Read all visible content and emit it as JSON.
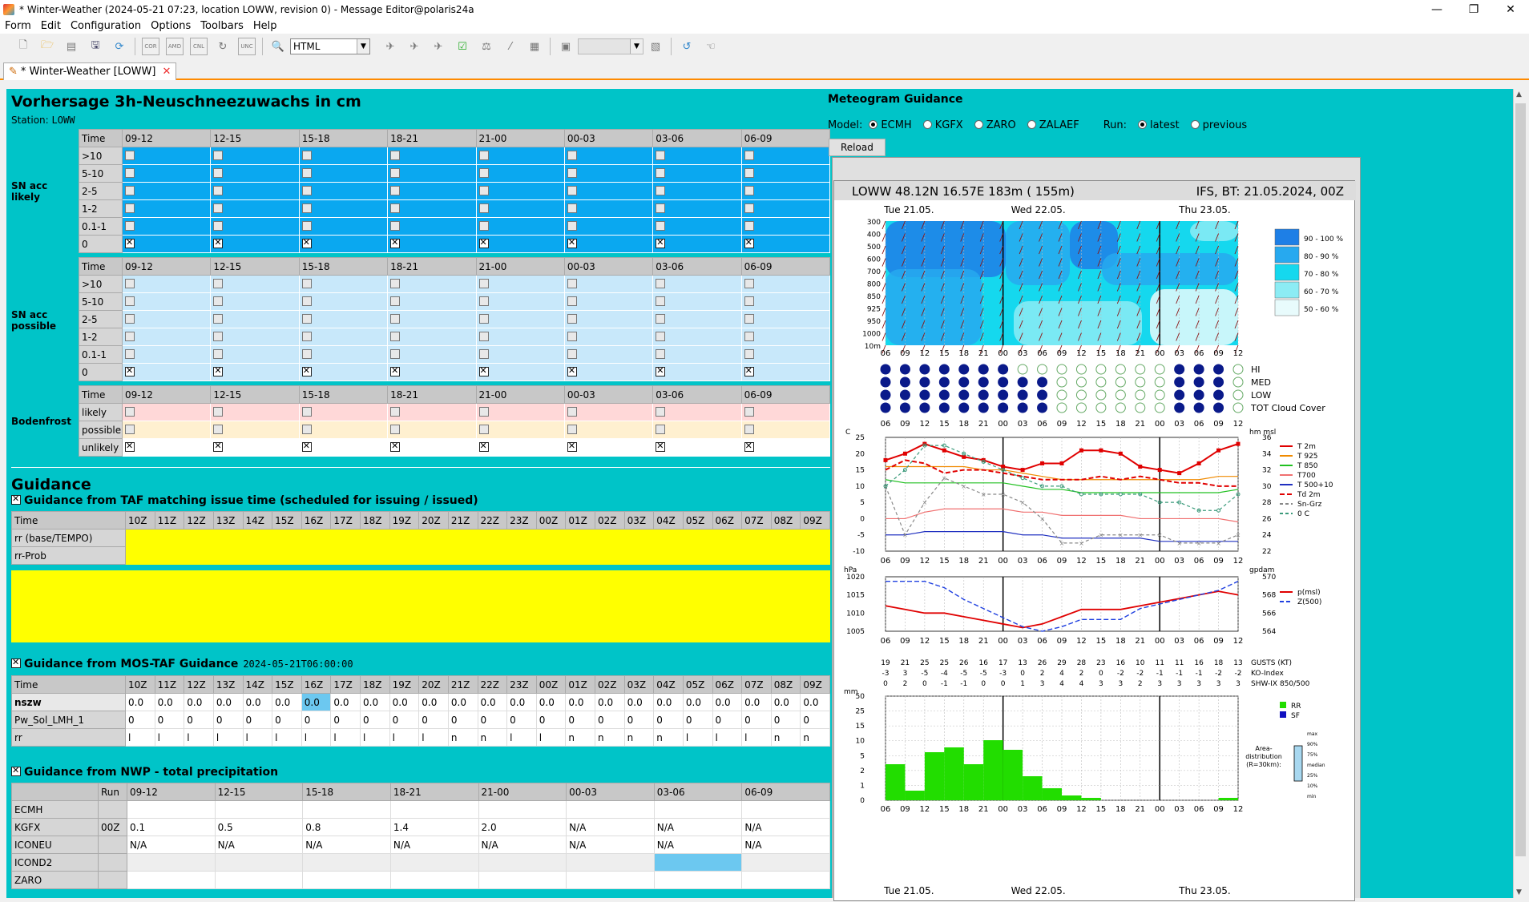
{
  "window": {
    "title": "* Winter-Weather (2024-05-21 07:23, location LOWW, revision 0) - Message Editor@polaris24a",
    "min": "—",
    "max": "❐",
    "close": "✕"
  },
  "menu": [
    "Form",
    "Edit",
    "Configuration",
    "Options",
    "Toolbars",
    "Help"
  ],
  "toolbar": {
    "format": "HTML",
    "icons": [
      "new-icon",
      "open-icon",
      "template-icon",
      "save-icon",
      "refresh-icon",
      "cor-icon",
      "amd-icon",
      "cnl-icon",
      "redo-icon",
      "unc-icon",
      "zoom-icon"
    ],
    "labels": {
      "cor": "COR",
      "amd": "AMD",
      "cnl": "CNL",
      "unc": "UNC"
    }
  },
  "tab": {
    "label": "* Winter-Weather [LOWW]",
    "close": "✕"
  },
  "left": {
    "title": "Vorhersage 3h-Neuschneezuwachs in cm",
    "station_label": "Station:",
    "station": "LOWW",
    "time_label": "Time",
    "periods": [
      "09-12",
      "12-15",
      "15-18",
      "18-21",
      "21-00",
      "00-03",
      "03-06",
      "06-09"
    ],
    "sn_likely": {
      "label_line1": "SN acc",
      "label_line2": "likely",
      "rows": [
        ">10",
        "5-10",
        "2-5",
        "1-2",
        "0.1-1",
        "0"
      ],
      "checked_row": "0"
    },
    "sn_possible": {
      "label_line1": "SN acc",
      "label_line2": "possible",
      "rows": [
        ">10",
        "5-10",
        "2-5",
        "1-2",
        "0.1-1",
        "0"
      ],
      "checked_row": "0"
    },
    "frost": {
      "label": "Bodenfrost",
      "rows": [
        "likely",
        "possible",
        "unlikely"
      ],
      "checked_row": "unlikely"
    },
    "guidance_title": "Guidance",
    "taf": {
      "title": "Guidance from TAF matching issue time (scheduled for issuing / issued)",
      "time_label": "Time",
      "hours": [
        "10Z",
        "11Z",
        "12Z",
        "13Z",
        "14Z",
        "15Z",
        "16Z",
        "17Z",
        "18Z",
        "19Z",
        "20Z",
        "21Z",
        "22Z",
        "23Z",
        "00Z",
        "01Z",
        "02Z",
        "03Z",
        "04Z",
        "05Z",
        "06Z",
        "07Z",
        "08Z",
        "09Z"
      ],
      "rows": [
        "rr (base/TEMPO)",
        "rr-Prob"
      ]
    },
    "mos": {
      "title": "Guidance from MOS-TAF Guidance",
      "timestamp": "2024-05-21T06:00:00",
      "time_label": "Time",
      "hours": [
        "10Z",
        "11Z",
        "12Z",
        "13Z",
        "14Z",
        "15Z",
        "16Z",
        "17Z",
        "18Z",
        "19Z",
        "20Z",
        "21Z",
        "22Z",
        "23Z",
        "00Z",
        "01Z",
        "02Z",
        "03Z",
        "04Z",
        "05Z",
        "06Z",
        "07Z",
        "08Z",
        "09Z"
      ],
      "rows": [
        {
          "label": "nszw",
          "values": [
            "0.0",
            "0.0",
            "0.0",
            "0.0",
            "0.0",
            "0.0",
            "0.0",
            "0.0",
            "0.0",
            "0.0",
            "0.0",
            "0.0",
            "0.0",
            "0.0",
            "0.0",
            "0.0",
            "0.0",
            "0.0",
            "0.0",
            "0.0",
            "0.0",
            "0.0",
            "0.0",
            "0.0"
          ]
        },
        {
          "label": "Pw_Sol_LMH_1",
          "values": [
            "0",
            "0",
            "0",
            "0",
            "0",
            "0",
            "0",
            "0",
            "0",
            "0",
            "0",
            "0",
            "0",
            "0",
            "0",
            "0",
            "0",
            "0",
            "0",
            "0",
            "0",
            "0",
            "0",
            "0"
          ]
        },
        {
          "label": "rr",
          "values": [
            "l",
            "l",
            "l",
            "l",
            "l",
            "l",
            "l",
            "l",
            "l",
            "l",
            "l",
            "n",
            "n",
            "l",
            "l",
            "n",
            "n",
            "n",
            "n",
            "l",
            "l",
            "l",
            "n",
            "n"
          ]
        }
      ],
      "highlight_col": 6
    },
    "nwp": {
      "title": "Guidance from NWP - total precipitation",
      "run_label": "Run",
      "periods": [
        "09-12",
        "12-15",
        "15-18",
        "18-21",
        "21-00",
        "00-03",
        "03-06",
        "06-09"
      ],
      "rows": [
        {
          "model": "ECMH",
          "run": "",
          "values": [
            "",
            "",
            "",
            "",
            "",
            "",
            "",
            ""
          ]
        },
        {
          "model": "KGFX",
          "run": "00Z",
          "values": [
            "0.1",
            "0.5",
            "0.8",
            "1.4",
            "2.0",
            "N/A",
            "N/A",
            "N/A"
          ]
        },
        {
          "model": "ICONEU",
          "run": "",
          "values": [
            "N/A",
            "N/A",
            "N/A",
            "N/A",
            "N/A",
            "N/A",
            "N/A",
            "N/A"
          ]
        },
        {
          "model": "ICOND2",
          "run": "",
          "values": [
            "",
            "",
            "",
            "",
            "",
            "",
            "",
            ""
          ]
        },
        {
          "model": "ZARO",
          "run": "",
          "values": [
            "",
            "",
            "",
            "",
            "",
            "",
            "",
            ""
          ]
        }
      ]
    }
  },
  "right": {
    "title": "Meteogram Guidance",
    "model_label": "Model:",
    "models": [
      "ECMH",
      "KGFX",
      "ZARO",
      "ZALAEF"
    ],
    "selected_model": "ECMH",
    "run_label": "Run:",
    "runs": [
      "latest",
      "previous"
    ],
    "selected_run": "latest",
    "reload": "Reload",
    "meteogram": {
      "header_left": "LOWW  48.12N  16.57E  183m  ( 155m)",
      "header_right": "IFS,   BT: 21.05.2024, 00Z",
      "days": [
        "Tue 21.05.",
        "Wed 22.05.",
        "Thu 23.05."
      ],
      "hours": [
        "06",
        "09",
        "12",
        "15",
        "18",
        "21",
        "00",
        "03",
        "06",
        "09",
        "12",
        "15",
        "18",
        "21",
        "00",
        "03",
        "06",
        "09",
        "12"
      ],
      "levels": [
        "300",
        "400",
        "500",
        "600",
        "700",
        "800",
        "850",
        "925",
        "950",
        "1000",
        "10m"
      ],
      "humidity_legend": [
        "90 - 100 %",
        "80 - 90 %",
        "70 - 80 %",
        "60 - 70 %",
        "50 - 60 %"
      ],
      "humidity_colors": [
        "#1e7fe6",
        "#27a9ef",
        "#15d8ee",
        "#8cecf4",
        "#e8fbfc"
      ],
      "cloud_labels": [
        "HI",
        "MED",
        "LOW",
        "TOT Cloud Cover"
      ],
      "temp": {
        "unit_left": "C",
        "unit_right": "hm msl",
        "y_left": [
          "25",
          "20",
          "15",
          "10",
          "5",
          "0",
          "-5",
          "-10"
        ],
        "y_right": [
          "36",
          "34",
          "32",
          "30",
          "28",
          "26",
          "24",
          "22"
        ],
        "legend": [
          "T 2m",
          "T 925",
          "T 850",
          "T700",
          "T 500+10",
          "Td 2m",
          "Sn-Grz",
          "0 C"
        ],
        "legend_colors": [
          "#e00000",
          "#f08a00",
          "#20c020",
          "#f07070",
          "#2030c0",
          "#e00000",
          "#888888",
          "#3a9a7a"
        ],
        "series": {
          "T 2m": [
            18,
            20,
            23,
            21,
            19,
            18,
            16,
            15,
            17,
            17,
            21,
            21,
            20,
            16,
            15,
            14,
            17,
            21,
            23
          ],
          "T 925": [
            16,
            16,
            16,
            16,
            16,
            15,
            15,
            14,
            13,
            12,
            12,
            12,
            12,
            12,
            12,
            12,
            12,
            13,
            13
          ],
          "T 850": [
            12,
            11,
            11,
            11,
            11,
            11,
            11,
            10,
            9,
            9,
            8,
            8,
            8,
            8,
            8,
            8,
            8,
            8,
            9
          ],
          "T700": [
            0,
            0,
            2,
            3,
            3,
            3,
            3,
            2,
            2,
            1,
            1,
            1,
            1,
            0,
            0,
            0,
            0,
            0,
            -1
          ],
          "T 500+10": [
            -5,
            -5,
            -4,
            -4,
            -4,
            -4,
            -4,
            -5,
            -5,
            -6,
            -6,
            -6,
            -6,
            -6,
            -7,
            -7,
            -7,
            -7,
            -7
          ],
          "Td 2m": [
            15,
            18,
            17,
            14,
            15,
            15,
            14,
            13,
            12,
            12,
            12,
            13,
            12,
            13,
            12,
            11,
            11,
            10,
            10
          ],
          "Sn-Grz": [
            30,
            24,
            28,
            31,
            30,
            29,
            29,
            28,
            26,
            23,
            23,
            24,
            24,
            24,
            24,
            23,
            23,
            23,
            24
          ],
          "0 C": [
            30,
            32,
            35,
            35,
            34,
            33,
            32,
            31,
            30,
            30,
            29,
            29,
            29,
            29,
            28,
            28,
            27,
            27,
            29
          ]
        }
      },
      "pressure": {
        "unit_left": "hPa",
        "unit_right": "gpdam",
        "y_left": [
          "1020",
          "1015",
          "1010",
          "1005"
        ],
        "y_right": [
          "570",
          "568",
          "566",
          "564"
        ],
        "legend": [
          "p(msl)",
          "Z(500)"
        ],
        "series": {
          "p(msl)": [
            1012,
            1011,
            1010,
            1010,
            1009,
            1008,
            1007,
            1006,
            1007,
            1009,
            1011,
            1011,
            1011,
            1012,
            1013,
            1014,
            1015,
            1016,
            1015
          ],
          "Z(500)": [
            569.5,
            569.5,
            569.5,
            568.8,
            567.5,
            566.5,
            565.5,
            564.5,
            564,
            564.5,
            565.3,
            565.3,
            565.3,
            566.5,
            567,
            567.5,
            568,
            568.5,
            569.5
          ]
        }
      },
      "indices": {
        "labels": [
          "GUSTS (KT)",
          "KO-Index",
          "SHW-IX 850/500"
        ],
        "gusts": [
          "19",
          "21",
          "25",
          "25",
          "26",
          "16",
          "17",
          "13",
          "26",
          "29",
          "28",
          "23",
          "16",
          "10",
          "11",
          "11",
          "16",
          "18",
          "13"
        ],
        "ko": [
          "-3",
          "3",
          "-5",
          "-4",
          "-5",
          "-5",
          "-3",
          "0",
          "2",
          "4",
          "2",
          "0",
          "-2",
          "-2",
          "-1",
          "-1",
          "-1",
          "-2",
          "-2"
        ],
        "shw": [
          "0",
          "2",
          "0",
          "-1",
          "-1",
          "0",
          "0",
          "1",
          "3",
          "4",
          "4",
          "3",
          "3",
          "2",
          "3",
          "3",
          "3",
          "3",
          "3"
        ]
      },
      "precip": {
        "unit": "mm",
        "y": [
          "50",
          "25",
          "15",
          "10",
          "5",
          "2",
          "1",
          "0"
        ],
        "legend": [
          "RR",
          "SF"
        ],
        "legend_colors": [
          "#22dd00",
          "#1010c0"
        ],
        "boxplot_labels": [
          "max",
          "90%",
          "75%",
          "median",
          "25%",
          "10%",
          "min"
        ],
        "boxplot_caption": "Area-\ndistribution\n(R=30km):"
      }
    }
  }
}
